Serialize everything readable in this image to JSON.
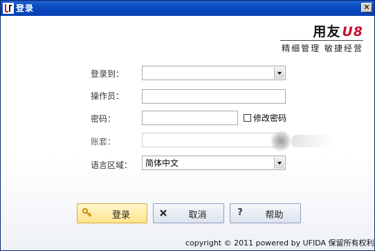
{
  "window": {
    "title": "登录",
    "close_label": "✕"
  },
  "brand": {
    "name": "用友",
    "version": "U8",
    "slogan": "精细管理 敏捷经营"
  },
  "form": {
    "login_to": {
      "label": "登录到：",
      "value": ""
    },
    "operator": {
      "label": "操作员：",
      "value": ""
    },
    "password": {
      "label": "密码：",
      "value": ""
    },
    "change_password": {
      "label": "修改密码",
      "checked": false
    },
    "account": {
      "label": "账套：",
      "value": ""
    },
    "language": {
      "label": "语言区域：",
      "value": "简体中文"
    }
  },
  "buttons": {
    "login": {
      "label": "登录",
      "icon": "key-icon"
    },
    "cancel": {
      "label": "取消",
      "icon": "x-icon"
    },
    "help": {
      "label": "帮助",
      "icon": "question-icon"
    }
  },
  "footer": {
    "copyright": "copyright © 2011 powered by UFIDA 保留所有权利"
  },
  "colors": {
    "titlebar": "#0a4ac0",
    "brand_red": "#c8102e",
    "login_button": "#ffe38a"
  }
}
